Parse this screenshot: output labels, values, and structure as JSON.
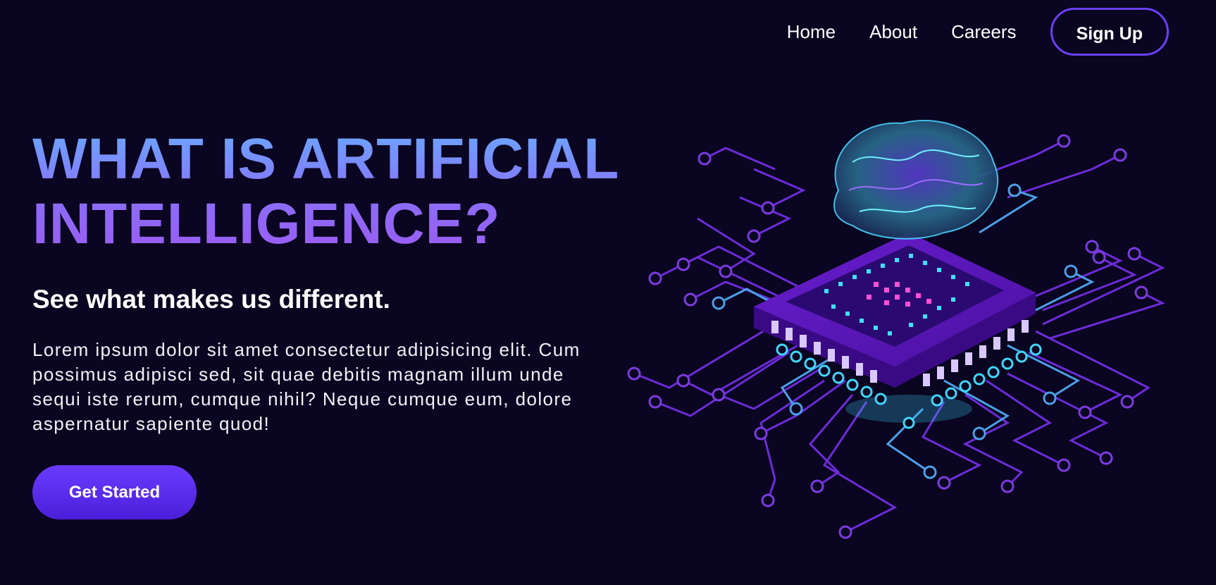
{
  "nav": {
    "items": [
      {
        "label": "Home"
      },
      {
        "label": "About"
      },
      {
        "label": "Careers"
      }
    ],
    "signup_label": "Sign Up"
  },
  "hero": {
    "title_line1": "WHAT IS ARTIFICIAL",
    "title_line2": "INTELLIGENCE?",
    "subtitle": "See what makes us different.",
    "body": "Lorem ipsum dolor sit amet consectetur adipisicing elit. Cum possimus adipisci sed, sit quae debitis magnam illum unde sequi iste rerum, cumque nihil? Neque cumque eum, dolore aspernatur sapiente quod!",
    "cta_label": "Get Started"
  },
  "illustration": {
    "icon": "brain-on-chip-illustration"
  },
  "colors": {
    "background": "#0a0520",
    "accent": "#6b3ff5",
    "title_top": "#6aa9ff",
    "title_bottom": "#9b5cf2"
  }
}
